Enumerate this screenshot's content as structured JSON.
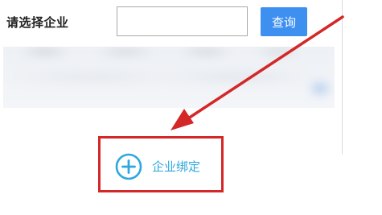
{
  "filter": {
    "label": "请选择企业",
    "input_value": "",
    "input_placeholder": ""
  },
  "query_button": {
    "label": "查询"
  },
  "bind_company": {
    "icon": "plus-circle-icon",
    "label": "企业绑定"
  },
  "colors": {
    "query_button": "#3d8ff0",
    "link_accent": "#2fa7dd",
    "annotation_red": "#d42727"
  }
}
